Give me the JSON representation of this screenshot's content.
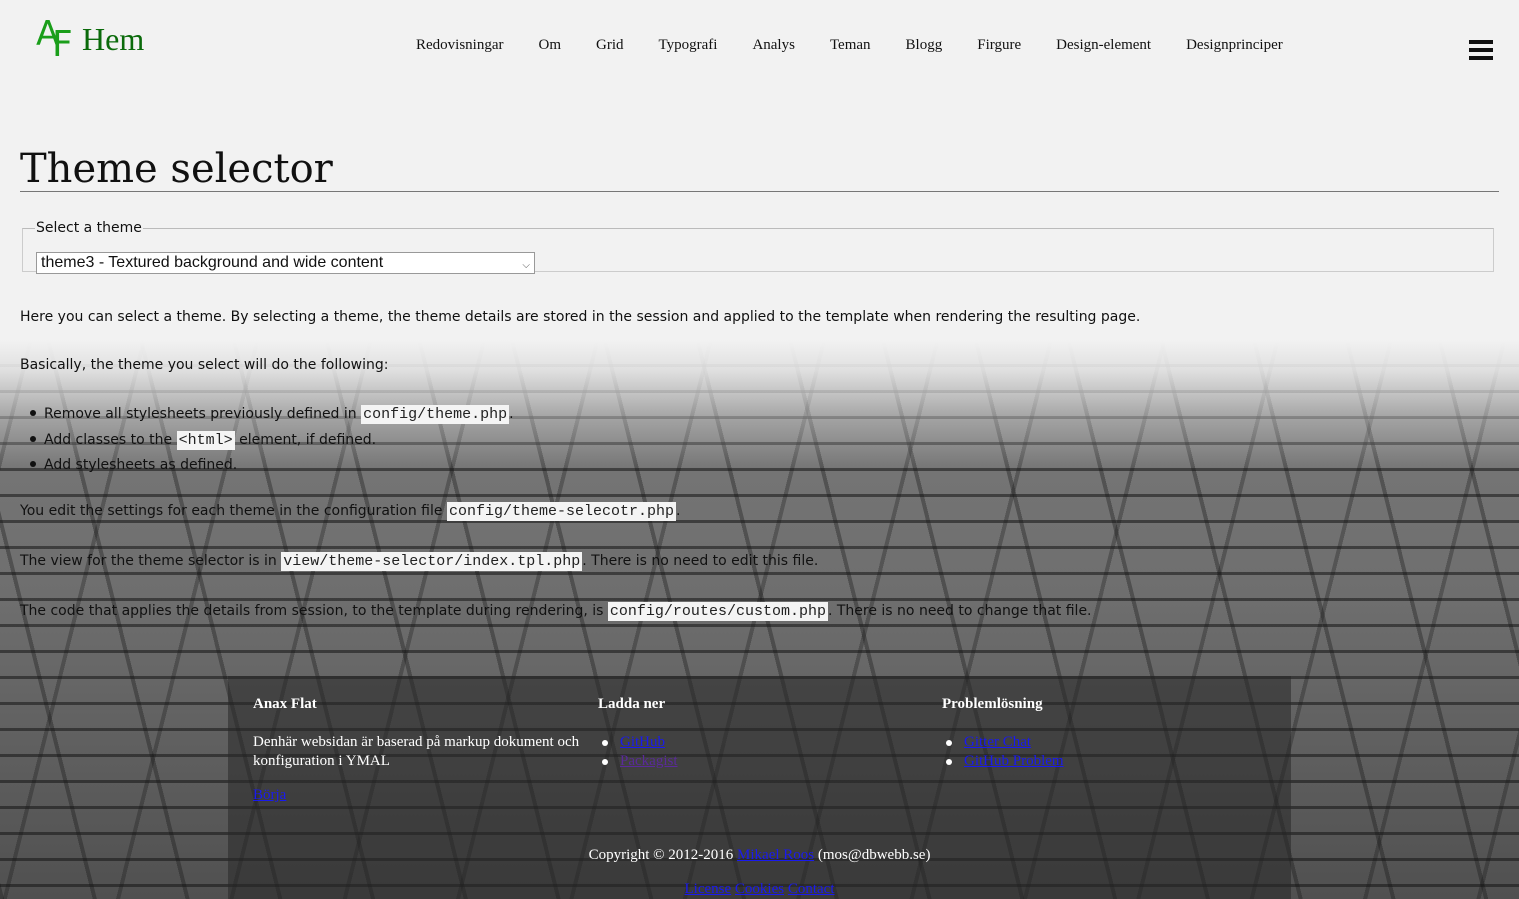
{
  "header": {
    "logo_a": "A",
    "logo_f": "F",
    "logo_text": "Hem",
    "nav": [
      "Redovisningar",
      "Om",
      "Grid",
      "Typografi",
      "Analys",
      "Teman",
      "Blogg",
      "Firgure",
      "Design-element",
      "Designprinciper"
    ]
  },
  "main": {
    "title": "Theme selector",
    "legend": "Select a theme",
    "select_value": "theme3 - Textured background and wide content",
    "intro": "Here you can select a theme. By selecting a theme, the theme details are stored in the session and applied to the template when rendering the resulting page.",
    "basically": "Basically, the theme you select will do the following:",
    "bullet1_pre": "Remove all stylesheets previously defined in ",
    "bullet1_code": "config/theme.php",
    "bullet1_post": ".",
    "bullet2_pre": "Add classes to the ",
    "bullet2_code": "<html>",
    "bullet2_post": " element, if defined.",
    "bullet3": "Add stylesheets as defined.",
    "edit_pre": "You edit the settings for each theme in the configuration file ",
    "edit_code": "config/theme-selecotr.php",
    "edit_post": ".",
    "view_pre": "The view for the theme selector is in ",
    "view_code": "view/theme-selector/index.tpl.php",
    "view_post": ". There is no need to edit this file.",
    "code_pre": "The code that applies the details from session, to the template during rendering, is ",
    "code_code": "config/routes/custom.php",
    "code_post": ". There is no need to change that file."
  },
  "footer": {
    "col1_title": "Anax Flat",
    "col1_text": "Denhär websidan är baserad på markup dokument och konfiguration i YMAL",
    "col1_link": "Börja",
    "col2_title": "Ladda ner",
    "col2_links": [
      "GitHub",
      "Packagist"
    ],
    "col3_title": "Problemlösning",
    "col3_links": [
      "Gitter Chat",
      "GitHub Problem"
    ],
    "copyright_pre": "Copyright © 2012-2016 ",
    "copyright_link": "Mikael Roos",
    "copyright_post": " (mos@dbwebb.se)",
    "links": [
      "License",
      "Cookies",
      "Contact"
    ]
  }
}
